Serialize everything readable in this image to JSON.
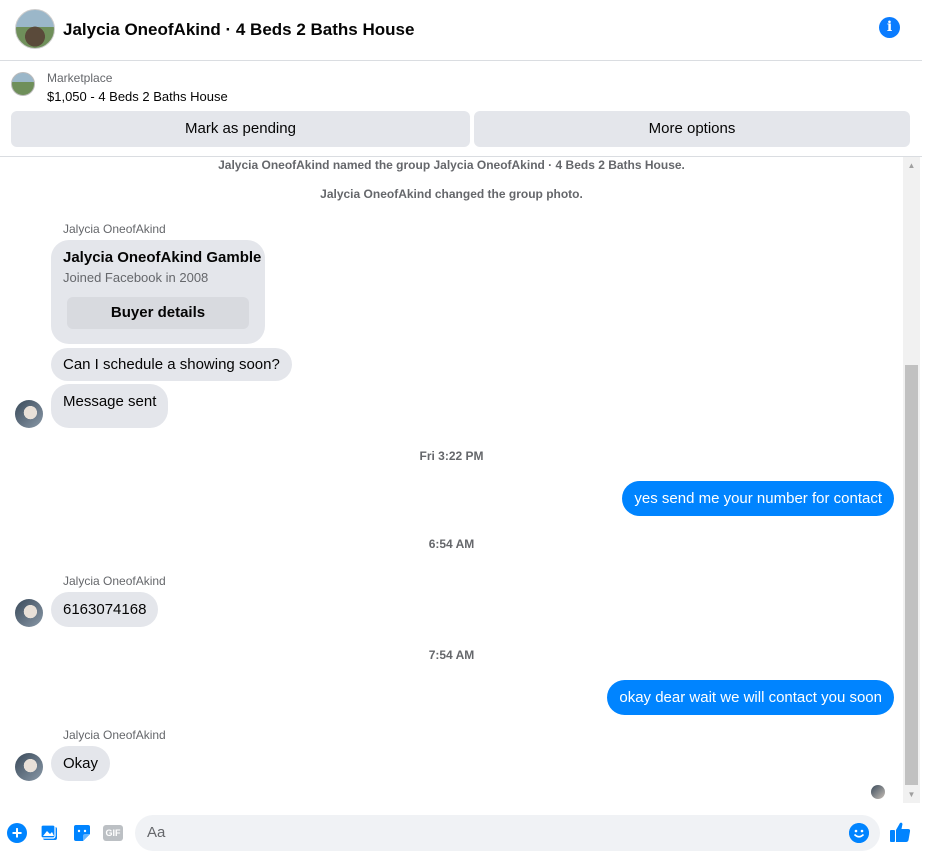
{
  "header": {
    "title": "Jalycia OneofAkind · 4 Beds 2 Baths House",
    "info_icon": "info-icon",
    "accent": "#0a7cff"
  },
  "listing": {
    "kicker": "Marketplace",
    "price_title": "$1,050 - 4 Beds 2 Baths House",
    "mark_pending_label": "Mark as pending",
    "more_options_label": "More options"
  },
  "thread": {
    "system_messages": [
      "Jalycia OneofAkind named the group Jalycia OneofAkind · 4 Beds 2 Baths House.",
      "Jalycia OneofAkind changed the group photo."
    ],
    "card": {
      "sender": "Jalycia OneofAkind",
      "name": "Jalycia OneofAkind Gamble",
      "joined": "Joined Facebook in 2008",
      "button_label": "Buyer details"
    },
    "incoming_1": "Can I schedule a showing soon?",
    "incoming_2": "Message sent",
    "timestamp_1": "Fri 3:22 PM",
    "outgoing_1": "yes send me your number for contact",
    "timestamp_2": "6:54 AM",
    "sender_2": "Jalycia OneofAkind",
    "incoming_3": "6163074168",
    "timestamp_3": "7:54 AM",
    "outgoing_2": "okay dear wait we will contact you soon",
    "sender_3": "Jalycia OneofAkind",
    "incoming_4": "Okay"
  },
  "composer": {
    "placeholder": "Aa",
    "gif_label": "GIF",
    "icons": [
      "plus-icon",
      "photo-icon",
      "sticker-icon",
      "gif-icon",
      "emoji-icon",
      "thumbs-up-icon"
    ]
  },
  "colors": {
    "outgoing_bubble": "#0084ff",
    "incoming_bubble": "#e4e6eb"
  }
}
